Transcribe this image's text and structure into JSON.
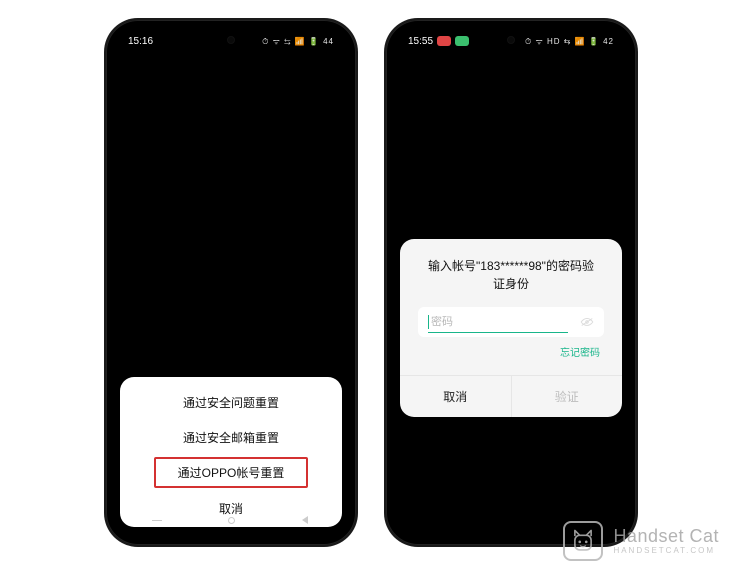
{
  "phone1": {
    "status": {
      "time": "15:16",
      "icons": "⏱ ᯤ ⇆ 📶 🔋 44"
    },
    "sheet": {
      "option_security": "通过安全问题重置",
      "option_email": "通过安全邮箱重置",
      "option_oppo": "通过OPPO帐号重置",
      "cancel": "取消"
    }
  },
  "phone2": {
    "status": {
      "time": "15:55",
      "icons": "⏱ ᯤ HD ⇆ 📶 🔋 42"
    },
    "dialog": {
      "title": "输入帐号\"183******98\"的密码验证身份",
      "placeholder": "密码",
      "forgot": "忘记密码",
      "cancel": "取消",
      "confirm": "验证"
    }
  },
  "watermark": {
    "name": "Handset Cat",
    "sub": "HANDSETCAT.COM"
  }
}
